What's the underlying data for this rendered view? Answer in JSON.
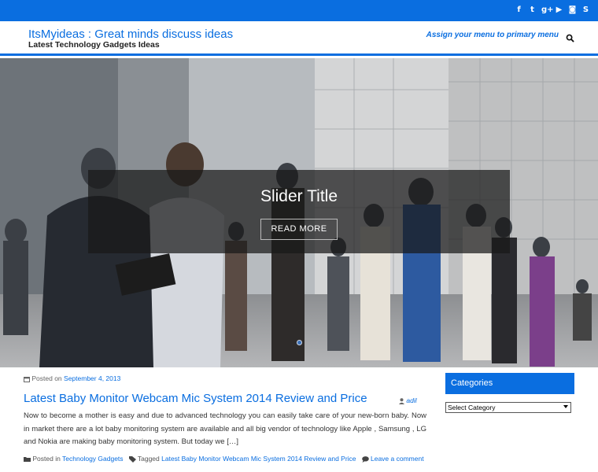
{
  "colors": {
    "accent": "#0a6ee0",
    "caption_bg": "#191919"
  },
  "topbar": {
    "social": [
      {
        "name": "facebook-icon",
        "glyph": "f"
      },
      {
        "name": "twitter-icon",
        "glyph": "t"
      },
      {
        "name": "google-plus-icon",
        "glyph": "g+"
      },
      {
        "name": "youtube-icon",
        "glyph": "▶"
      },
      {
        "name": "instagram-icon",
        "glyph": "◙"
      },
      {
        "name": "skype-icon",
        "glyph": "S"
      }
    ]
  },
  "header": {
    "site_title": "ItsMyideas : Great minds discuss ideas",
    "site_description": "Latest Technology Gadgets Ideas",
    "menu_note": "Assign your menu to primary menu"
  },
  "slider": {
    "title": "Slider Title",
    "read_more": "READ MORE"
  },
  "post": {
    "posted_on": "Posted on",
    "date": "September 4, 2013",
    "title": "Latest Baby Monitor Webcam Mic System 2014 Review and Price",
    "author": "adil",
    "excerpt": "Now to become a mother is easy and due to advanced technology you can easily take care of your new-born baby. Now in market there are a lot baby monitoring system are available and all big vendor of technology like Apple , Samsung , LG and Nokia are making baby monitoring system. But today we […]",
    "posted_in_label": "Posted in",
    "category": "Technology Gadgets",
    "tagged_label": "Tagged",
    "tag": "Latest Baby Monitor Webcam Mic System 2014 Review and Price",
    "comment": "Leave a comment"
  },
  "sidebar": {
    "widget_title": "Categories",
    "select_value": "Select Category"
  }
}
